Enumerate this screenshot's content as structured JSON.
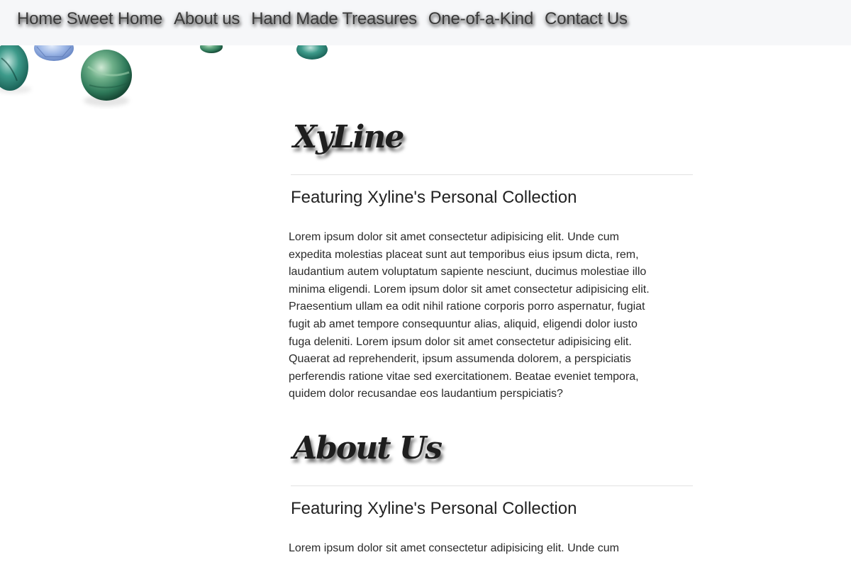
{
  "nav": {
    "items": [
      {
        "label": "Home Sweet Home"
      },
      {
        "label": "About us"
      },
      {
        "label": "Hand Made Treasures"
      },
      {
        "label": "One-of-a-Kind"
      },
      {
        "label": "Contact Us"
      }
    ]
  },
  "sections": [
    {
      "heading": "XyLine",
      "subtitle": "Featuring Xyline's Personal Collection",
      "body": "Lorem ipsum dolor sit amet consectetur adipisicing elit. Unde cum expedita molestias placeat sunt aut temporibus eius ipsum dicta, rem, laudantium autem voluptatum sapiente nesciunt, ducimus molestiae illo minima eligendi. Lorem ipsum dolor sit amet consectetur adipisicing elit. Praesentium ullam ea odit nihil ratione corporis porro aspernatur, fugiat fugit ab amet tempore consequuntur alias, aliquid, eligendi dolor iusto fuga deleniti. Lorem ipsum dolor sit amet consectetur adipisicing elit. Quaerat ad reprehenderit, ipsum assumenda dolorem, a perspiciatis perferendis ratione vitae sed exercitationem. Beatae eveniet tempora, quidem dolor recusandae eos laudantium perspiciatis?"
    },
    {
      "heading": "About Us",
      "subtitle": "Featuring Xyline's Personal Collection",
      "body": "Lorem ipsum dolor sit amet consectetur adipisicing elit. Unde cum"
    }
  ],
  "colors": {
    "navbar_bg": "#f6f7f9",
    "nav_text": "#3a3a3a",
    "bead_green": "#2f7a5a",
    "bead_blue": "#7d9fd6"
  }
}
